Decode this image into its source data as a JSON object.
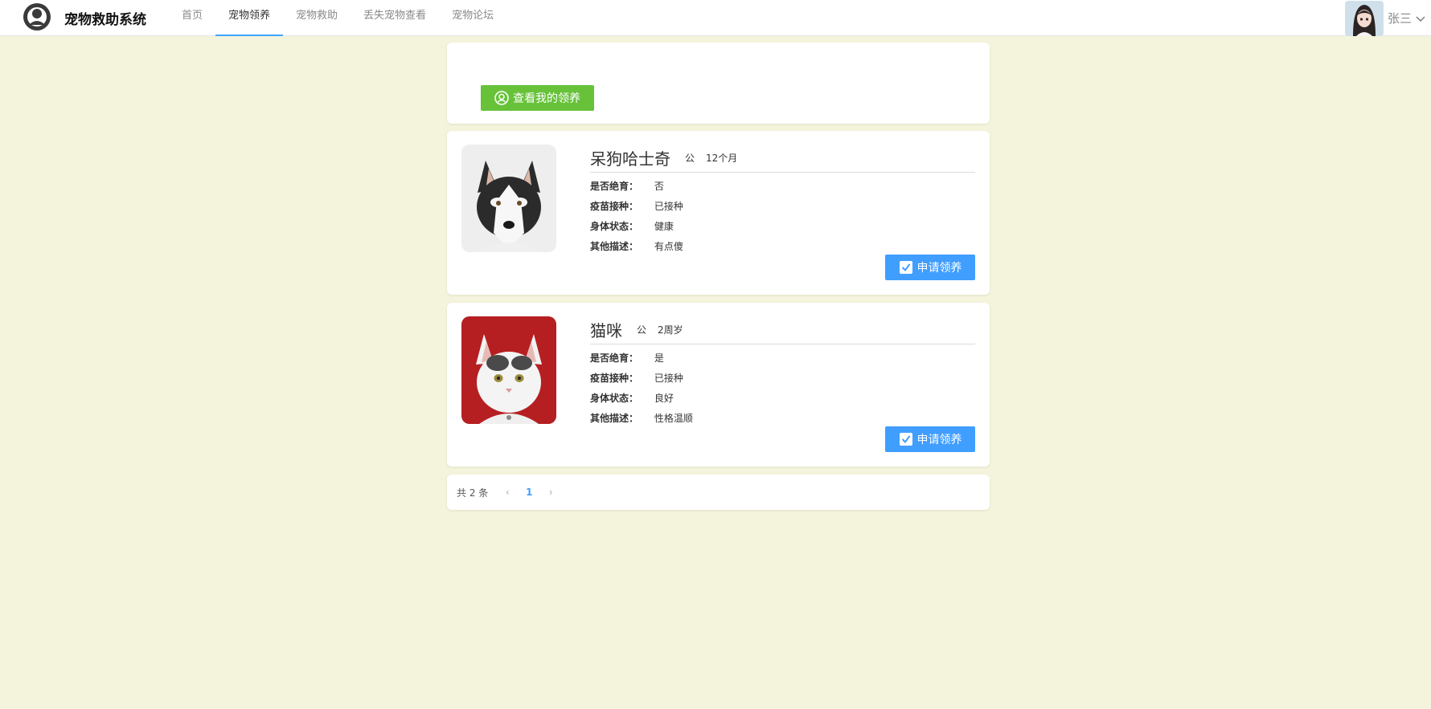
{
  "header": {
    "app_title": "宠物救助系统",
    "nav": [
      "首页",
      "宠物领养",
      "宠物救助",
      "丢失宠物查看",
      "宠物论坛"
    ],
    "active_nav": "宠物领养",
    "user_name": "张三"
  },
  "toolbar": {
    "my_adoption_label": "查看我的领养"
  },
  "pets": [
    {
      "name": "呆狗哈士奇",
      "gender": "公",
      "age": "12个月",
      "fields": [
        {
          "label": "是否绝育：",
          "value": "否"
        },
        {
          "label": "疫苗接种：",
          "value": "已接种"
        },
        {
          "label": "身体状态：",
          "value": "健康"
        },
        {
          "label": "其他描述：",
          "value": "有点傻"
        }
      ],
      "action_label": "申请领养"
    },
    {
      "name": "猫咪",
      "gender": "公",
      "age": "2周岁",
      "fields": [
        {
          "label": "是否绝育：",
          "value": "是"
        },
        {
          "label": "疫苗接种：",
          "value": "已接种"
        },
        {
          "label": "身体状态：",
          "value": "良好"
        },
        {
          "label": "其他描述：",
          "value": "性格温顺"
        }
      ],
      "action_label": "申请领养"
    }
  ],
  "pagination": {
    "total_text": "共 2 条",
    "prev": "‹",
    "current_page": "1",
    "next": "›"
  },
  "colors": {
    "page_bg": "#f4f4dc",
    "green_button": "#67c23a",
    "blue_button": "#409eff",
    "active_tab_underline": "#3ea6ff"
  }
}
